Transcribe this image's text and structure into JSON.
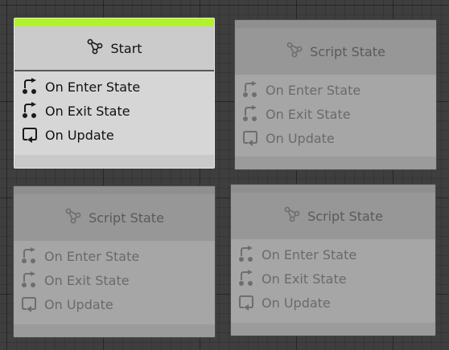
{
  "nodes": [
    {
      "title": "Start",
      "header_icon": "state-graph-icon",
      "active": true,
      "rows": [
        {
          "icon": "enter-state-icon",
          "label": "On Enter State"
        },
        {
          "icon": "exit-state-icon",
          "label": "On Exit State"
        },
        {
          "icon": "update-loop-icon",
          "label": "On Update"
        }
      ]
    },
    {
      "title": "Script State",
      "header_icon": "state-graph-icon",
      "active": false,
      "rows": [
        {
          "icon": "enter-state-icon",
          "label": "On Enter State"
        },
        {
          "icon": "exit-state-icon",
          "label": "On Exit State"
        },
        {
          "icon": "update-loop-icon",
          "label": "On Update"
        }
      ]
    },
    {
      "title": "Script State",
      "header_icon": "state-graph-icon",
      "active": false,
      "rows": [
        {
          "icon": "enter-state-icon",
          "label": "On Enter State"
        },
        {
          "icon": "exit-state-icon",
          "label": "On Exit State"
        },
        {
          "icon": "update-loop-icon",
          "label": "On Update"
        }
      ]
    },
    {
      "title": "Script State",
      "header_icon": "state-graph-icon",
      "active": false,
      "rows": [
        {
          "icon": "enter-state-icon",
          "label": "On Enter State"
        },
        {
          "icon": "exit-state-icon",
          "label": "On Exit State"
        },
        {
          "icon": "update-loop-icon",
          "label": "On Update"
        }
      ]
    }
  ],
  "colors": {
    "canvas": "#3e3e3e",
    "active_accent": "#b2f12c",
    "active_body": "#d6d6d6",
    "inactive_body": "#a6a6a6"
  }
}
